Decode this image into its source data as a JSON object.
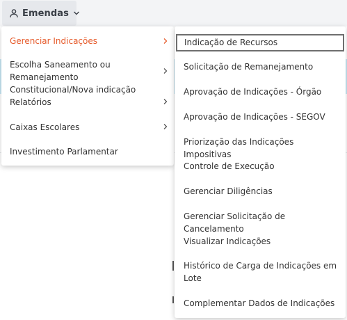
{
  "nav": {
    "menu_label": "Emendas",
    "user_icon": "user-icon",
    "chevron_icon": "chevron-down-icon"
  },
  "menu": {
    "items": [
      {
        "label": "Gerenciar Indicações",
        "has_submenu": true,
        "active": true
      },
      {
        "label": "Escolha Saneamento ou Remanejamento Constitucional/Nova indicação",
        "has_submenu": true,
        "active": false
      },
      {
        "label": "Relatórios",
        "has_submenu": true,
        "active": false
      },
      {
        "label": "Caixas Escolares",
        "has_submenu": true,
        "active": false
      },
      {
        "label": "Investimento Parlamentar",
        "has_submenu": false,
        "active": false
      }
    ]
  },
  "submenu": {
    "items": [
      {
        "label": "Indicação de Recursos",
        "focused": true
      },
      {
        "label": "Solicitação de Remanejamento"
      },
      {
        "label": "Aprovação de Indicações - Órgão"
      },
      {
        "label": "Aprovação de Indicações - SEGOV"
      },
      {
        "label": "Priorização das Indicações Impositivas"
      },
      {
        "label": "Controle de Execução"
      },
      {
        "label": "Gerenciar Diligências"
      },
      {
        "label": "Gerenciar Solicitação de Cancelamento"
      },
      {
        "label": "Visualizar Indicações"
      },
      {
        "label": "Histórico de Carga de Indicações em Lote"
      },
      {
        "label": "Complementar Dados de Indicações"
      }
    ]
  },
  "colors": {
    "active_item": "#e65a2a",
    "text": "#333333",
    "nav_background": "#e6e8ec",
    "focus_border": "#6e6e6e",
    "background_band": "#c9e9f6"
  }
}
